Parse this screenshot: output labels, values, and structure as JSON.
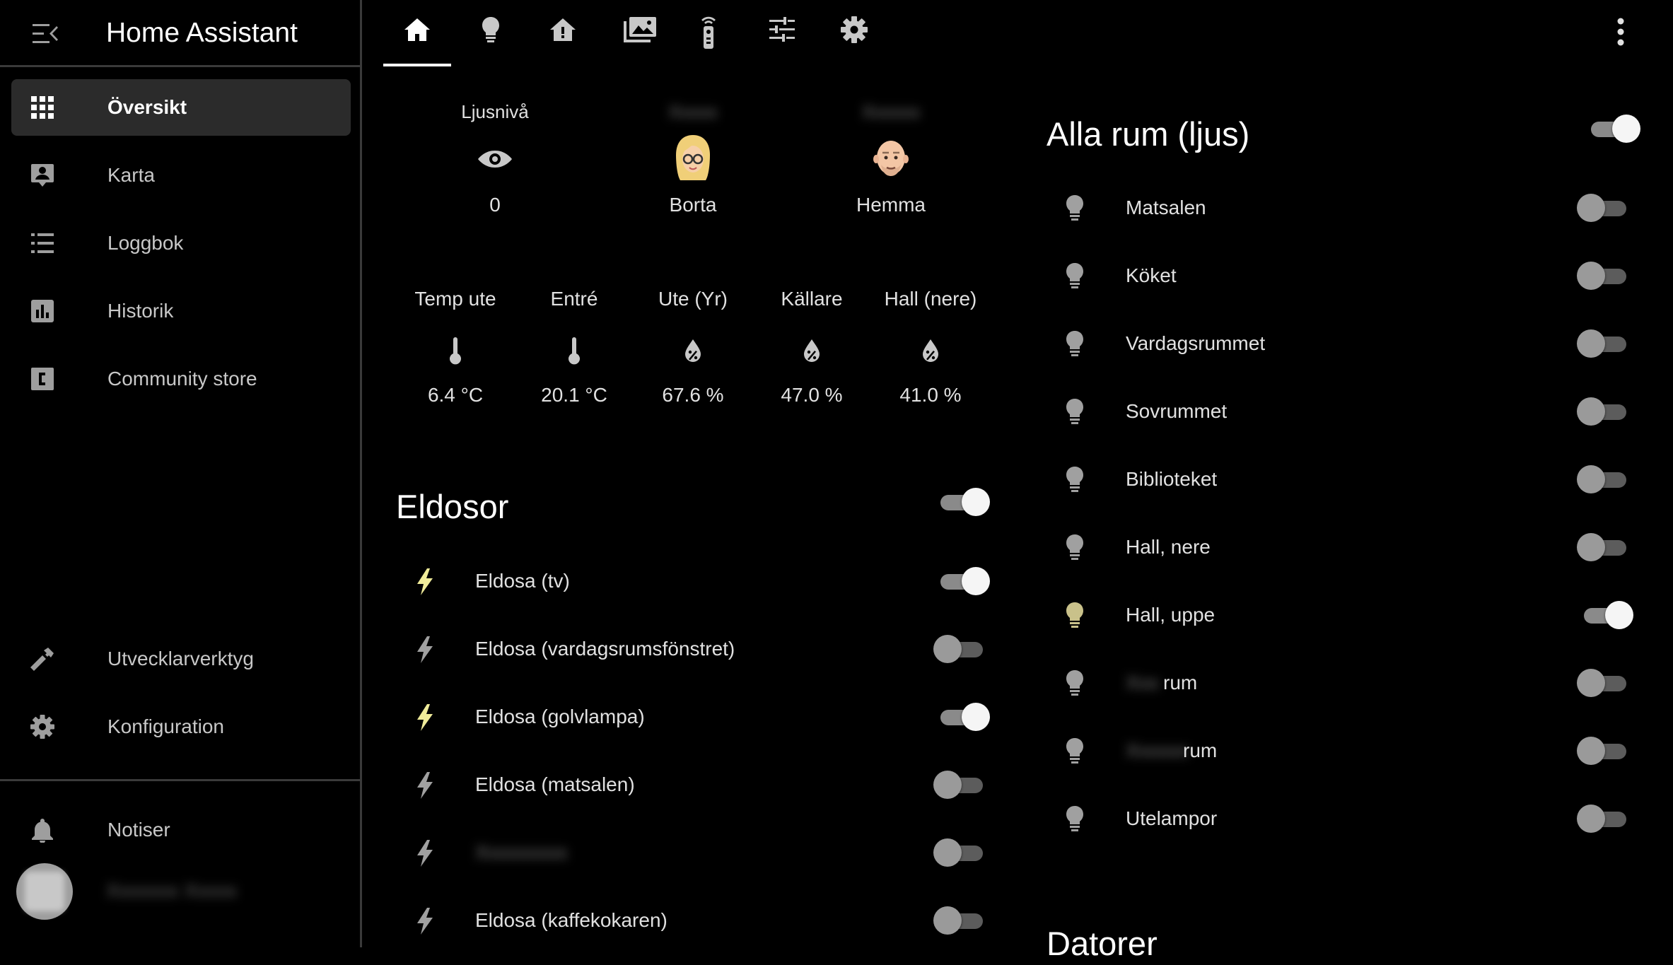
{
  "app": {
    "title": "Home Assistant"
  },
  "sidebar": {
    "items": [
      {
        "label": "Översikt",
        "icon": "grid-icon",
        "active": true
      },
      {
        "label": "Karta",
        "icon": "account-box-icon"
      },
      {
        "label": "Loggbok",
        "icon": "list-icon"
      },
      {
        "label": "Historik",
        "icon": "chart-box-icon"
      },
      {
        "label": "Community store",
        "icon": "community-store-icon"
      }
    ],
    "bottom_items": [
      {
        "label": "Utvecklarverktyg",
        "icon": "hammer-icon"
      },
      {
        "label": "Konfiguration",
        "icon": "gear-icon"
      }
    ],
    "notifications_label": "Notiser"
  },
  "tabs": [
    "home-icon",
    "bulb-icon",
    "house-alert-icon",
    "image-multiple-icon",
    "remote-icon",
    "tune-icon",
    "gear-icon"
  ],
  "badges": [
    {
      "label": "Ljusnivå",
      "value": "0",
      "icon": "eye-icon"
    },
    {
      "label": "",
      "value": "Borta",
      "icon": "avatar"
    },
    {
      "label": "",
      "value": "Hemma",
      "icon": "avatar"
    }
  ],
  "sensors": [
    {
      "label": "Temp ute",
      "value": "6.4 °C",
      "icon": "thermometer-icon"
    },
    {
      "label": "Entré",
      "value": "20.1 °C",
      "icon": "thermometer-icon"
    },
    {
      "label": "Ute (Yr)",
      "value": "67.6 %",
      "icon": "humidity-icon"
    },
    {
      "label": "Källare",
      "value": "47.0 %",
      "icon": "humidity-icon"
    },
    {
      "label": "Hall (nere)",
      "value": "41.0 %",
      "icon": "humidity-icon"
    }
  ],
  "eldosor": {
    "title": "Eldosor",
    "master_on": true,
    "items": [
      {
        "label": "Eldosa (tv)",
        "on": true
      },
      {
        "label": "Eldosa (vardagsrumsfönstret)",
        "on": false
      },
      {
        "label": "Eldosa (golvlampa)",
        "on": true
      },
      {
        "label": "Eldosa (matsalen)",
        "on": false
      },
      {
        "label": "",
        "on": false
      },
      {
        "label": "Eldosa (kaffekokaren)",
        "on": false
      }
    ]
  },
  "alla_rum": {
    "title": "Alla rum (ljus)",
    "master_on": true,
    "items": [
      {
        "label": "Matsalen",
        "on": false
      },
      {
        "label": "Köket",
        "on": false
      },
      {
        "label": "Vardagsrummet",
        "on": false
      },
      {
        "label": "Sovrummet",
        "on": false
      },
      {
        "label": "Biblioteket",
        "on": false
      },
      {
        "label": "Hall, nere",
        "on": false
      },
      {
        "label": "Hall, uppe",
        "on": true
      },
      {
        "label": "rum",
        "on": false
      },
      {
        "label": "rum",
        "on": false
      },
      {
        "label": "Utelampor",
        "on": false
      }
    ]
  },
  "next_card_title": "Datorer",
  "colors": {
    "bulb_on": "#c9c18a",
    "bolt_on": "#f0ec9a",
    "icon_off": "#a0a0a0"
  }
}
